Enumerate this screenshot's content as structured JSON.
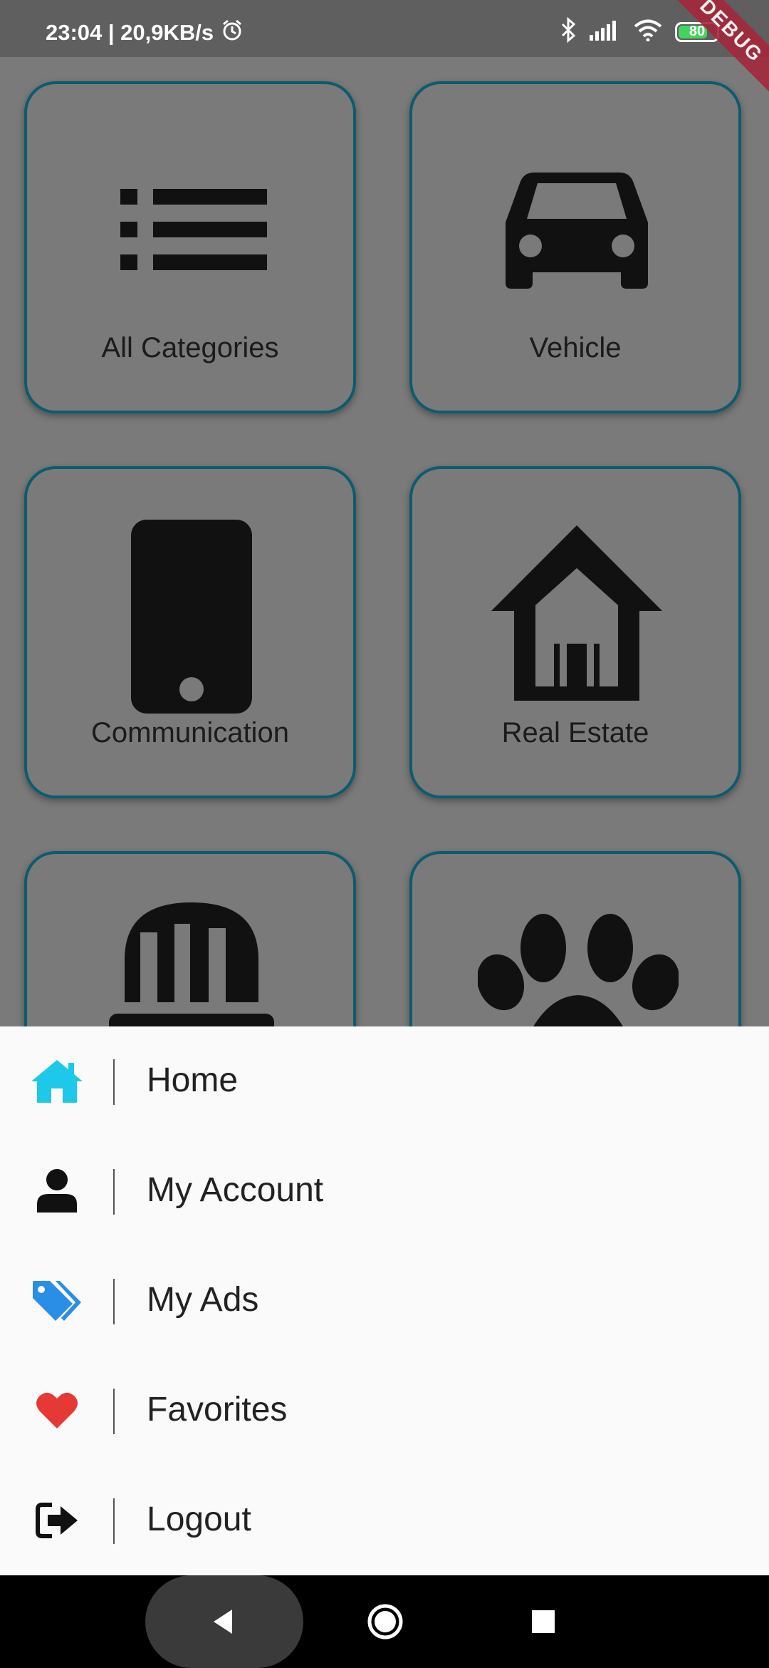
{
  "status_bar": {
    "time_speed": "23:04 | 20,9KB/s",
    "battery": "80",
    "debug_banner": "DEBUG"
  },
  "categories": [
    {
      "label": "All Categories",
      "icon": "list-icon"
    },
    {
      "label": "Vehicle",
      "icon": "car-icon"
    },
    {
      "label": "Communication",
      "icon": "phone-icon"
    },
    {
      "label": "Real Estate",
      "icon": "house-icon"
    },
    {
      "label": "",
      "icon": "helmet-icon"
    },
    {
      "label": "",
      "icon": "paw-icon"
    }
  ],
  "drawer": {
    "items": [
      {
        "label": "Home",
        "icon": "home-icon",
        "color": "#1ec8e8"
      },
      {
        "label": "My Account",
        "icon": "user-icon",
        "color": "#111111"
      },
      {
        "label": "My Ads",
        "icon": "tags-icon",
        "color": "#2b8ee6"
      },
      {
        "label": "Favorites",
        "icon": "heart-icon",
        "color": "#e53935"
      },
      {
        "label": "Logout",
        "icon": "logout-icon",
        "color": "#111111"
      }
    ]
  },
  "colors": {
    "card_border": "#0d5b6e",
    "overlay_background": "#7a7a7a",
    "drawer_background": "#fafafa"
  }
}
